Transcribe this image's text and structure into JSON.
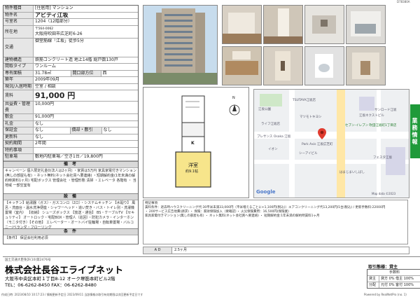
{
  "doc_code": "D78380A",
  "property": {
    "type_label": "物件種目",
    "type_value": "[住居用]  マンション",
    "name_label": "物件名",
    "name_value": "アビティ江坂",
    "room_label": "号室名",
    "room_value": "1204（12階部分）",
    "addr_label": "所在地",
    "addr_zip": "〒564-0062",
    "addr_value": "大阪府吹田市広芝町6-26",
    "traffic_label": "交通",
    "traffic_value": "御堂筋線「江坂」徒歩5分",
    "structure_label": "建物構造",
    "structure_value": "鉄筋コンクリート造  地上14階  総戸数130戸",
    "layout_label": "間取タイプ",
    "layout_value": "ワンルーム",
    "area_label": "専有面積",
    "area_value": "31.78㎡",
    "balcony_label": "間口部方位",
    "balcony_value": "西",
    "built_label": "築年",
    "built_value": "2009年09月",
    "status_label": "現況/入居時期",
    "status_value": "空室 / 相談",
    "rent_label": "賃料",
    "rent_value": "91,000 円",
    "mgmt_label": "共益費・管理費",
    "mgmt_value": "10,000円",
    "deposit_label": "敷金",
    "deposit_value": "91,000円",
    "key_label": "礼金",
    "key_value": "なし",
    "guarantee_label": "保証金",
    "guarantee_value": "なし",
    "amort_label": "償却・敷引",
    "amort_value": "なし",
    "renew_label": "更新料",
    "renew_value": "なし",
    "period_label": "契約期間",
    "period_value": "2年間",
    "conditions_label": "特約事項",
    "conditions_value": "",
    "parking_label": "駐車場",
    "parking_value": "敷地内駐車場／空き1台／19,800円"
  },
  "remarks": {
    "title": "備  考",
    "text": "キャンペーン  個人限定礼金0(法人は2ヶ月) ・家賃は5万円 家具家電付きマンション(無しの部屋も有)  ・ネット無料(ネット会社買へ要連絡) ・短期解約金(1年未満の解約時賃料1ヶ月) 宅配ボックス  管理会社 ・管理形態  清掃 ・エレベータ  各階有 ・ 当地域 一部空室有"
  },
  "facilities": {
    "title": "設  備",
    "text": "【キッチン】給湯器（ガス）・ガスコンロ（2口）・システムキッチン 【水廻り】 風呂・洗面台・温水洗浄便座・シャワーヘッド・追い焚き・バス・トイレ別・洗濯機置場（室内） 【収納】 シューズボックス 【放送・通信】 BS・ケーブルTV 【セキュリティ】 オートロック・宅配BOX・管理人（巡回）・防犯カメラ・インターホン（モニタ付き）【その他】 エレベーター・オートバイ駐輪場・自転車置場・バルコニー/ベランダ・フローリング"
  },
  "conditions": {
    "title": "条  件",
    "text": "【条件】 保証会社利用必須"
  },
  "floorplan": {
    "room_label": "洋室",
    "room_size": "約9.1帖",
    "kitchen_label": "K",
    "compass": "N"
  },
  "map": {
    "labels": [
      "江坂公園",
      "TSUTAYA江坂店",
      "マツモトキヨシ",
      "ライフ江坂店",
      "Park Axis 江坂広芝町",
      "江坂ネクストビル",
      "プレサンス Osaka 江坂",
      "シーアイビル",
      "イオン",
      "サンロード江坂",
      "セブン-イレブン 吹田江坂町1丁目店",
      "フェスタ江坂",
      "はまじまいしばし",
      "Map data ©2023"
    ],
    "google": "Google"
  },
  "notes": {
    "line1": "特記事項",
    "line2": "賃料条件：退去時ハウスクリーニング代:30平米未満33,000円（平米増えるごとに+1,100円(税込)）エアコンクリーニング代13,200円/1台(税込) / 更新手数料:22000円",
    "line3": "・ 200サービス広告他費(請求) ・ 保険：家財保険加入（要確認）・ 火災保険費用：16,500円(保険業)",
    "line4": "家具家電付きマンション(無しの部屋も有) ・ ネット無料(ネット会社買へ要連絡) ・ 短期解約金:1年未満の解約時賃料1ヶ月"
  },
  "sidebar_label": "業務情報",
  "mini_table": {
    "a_label": "A D",
    "a_value": "2.5ヶ月"
  },
  "footer": {
    "license": "国土交通大臣免許(10)第2476号",
    "company": "株式会社長谷エライブネット",
    "address": "大阪市中央区本町１丁目8-12 オーク堺筋本町ビル2階",
    "tel": "TEL：06-6262-8450  FAX：06-6262-8480",
    "trade_label": "取引態様：貸主",
    "fee_title": "手数料",
    "fee_r1c1": "貸主",
    "fee_r1c2": "貸方 0% 借主 100%",
    "fee_r2c1": "分配",
    "fee_r2c2": "元付 0% 客付 100%",
    "print_date": "作成日時: 2023/08/10 10:17:23 / 情報更新予定日 2023/09/11 当該情報の取引有効期限は次回更新予定日です",
    "powered": "Powered by RealNetPro (no. 1)"
  },
  "colors": {
    "accent_green": "#1f9a3a",
    "label_bg": "#e6e6e6",
    "map_pin": "#e03b2f"
  }
}
